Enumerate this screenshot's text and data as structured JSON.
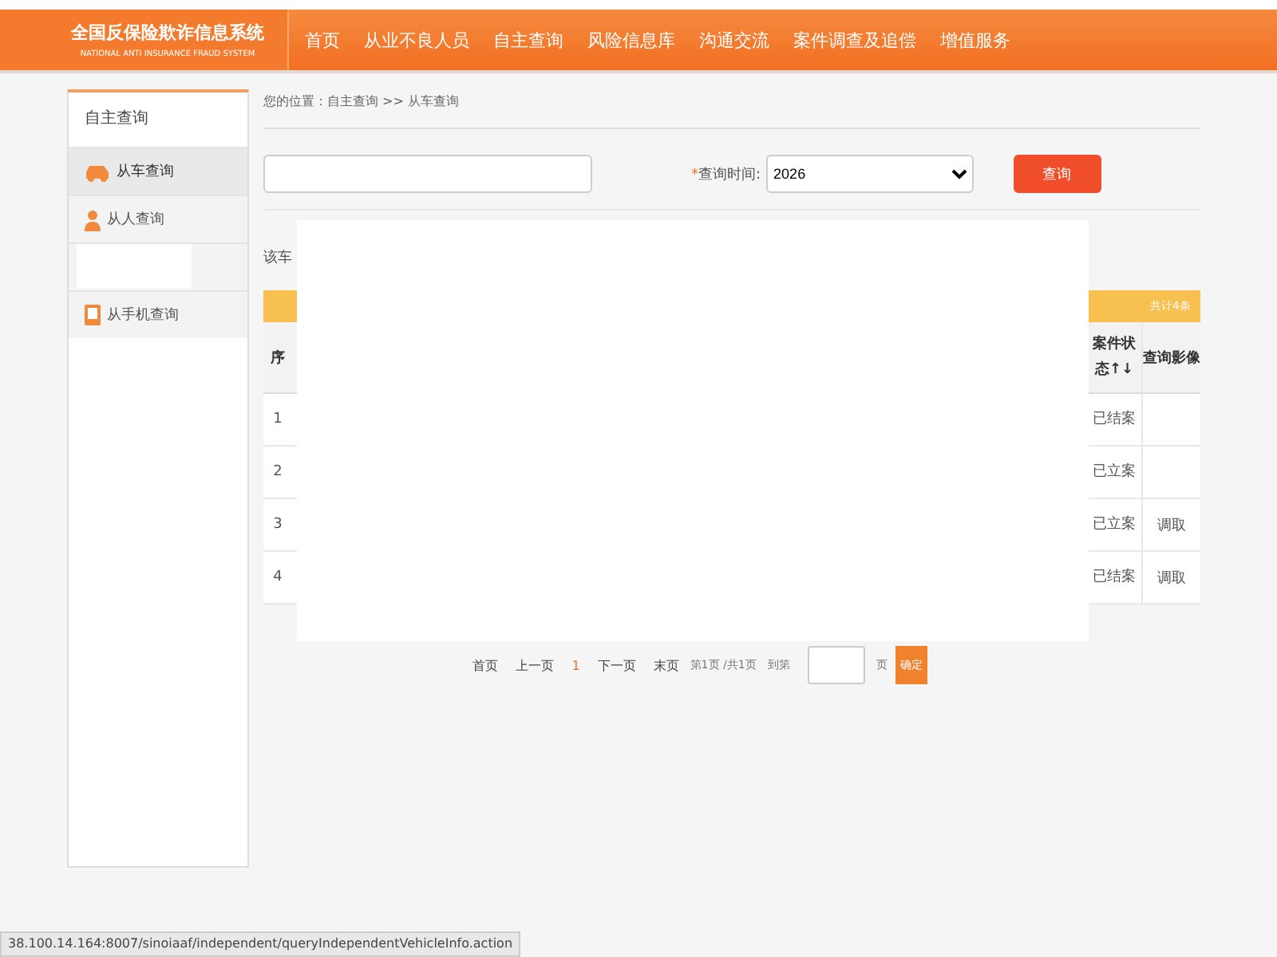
{
  "header": {
    "logo_title": "全国反保险欺诈信息系统",
    "logo_subtitle": "NATIONAL ANTI INSURANCE FRAUD SYSTEM",
    "nav": [
      {
        "label": "首页"
      },
      {
        "label": "从业不良人员"
      },
      {
        "label": "自主查询"
      },
      {
        "label": "风险信息库"
      },
      {
        "label": "沟通交流"
      },
      {
        "label": "案件调查及追偿"
      },
      {
        "label": "增值服务"
      }
    ]
  },
  "sidebar": {
    "title": "自主查询",
    "items": [
      {
        "label": "从车查询",
        "kind": "car",
        "selected": true
      },
      {
        "label": "从人查询",
        "kind": "person",
        "selected": false
      },
      {
        "label": "从手机查询",
        "kind": "phone",
        "selected": false
      }
    ]
  },
  "breadcrumb": "您的位置：自主查询 >> 从车查询",
  "search": {
    "time_label": "查询时间:",
    "required_mark": "*",
    "year": "2026",
    "button": "查询"
  },
  "vehicle_label": "该车",
  "table": {
    "total": "共计4条",
    "columns": [
      {
        "label": "序"
      },
      {
        "label": "案件状态↑↓"
      },
      {
        "label": "查询影像"
      }
    ],
    "rows": [
      {
        "no": "1",
        "status": "已结案"
      },
      {
        "no": "2",
        "status": "已立案"
      },
      {
        "no": "3",
        "status": "已立案",
        "image": "调取"
      },
      {
        "no": "4",
        "status": "已结案",
        "image": "调取"
      }
    ]
  },
  "pager": {
    "first": "首页",
    "prev": "上一页",
    "current": "1",
    "next": "下一页",
    "last": "末页",
    "info": "第1页 /共1页",
    "goto": "到第",
    "unit": "页",
    "confirm": "确定"
  },
  "status_bar": "38.100.14.164:8007/sinoiaaf/independent/queryIndependentVehicleInfo.action"
}
